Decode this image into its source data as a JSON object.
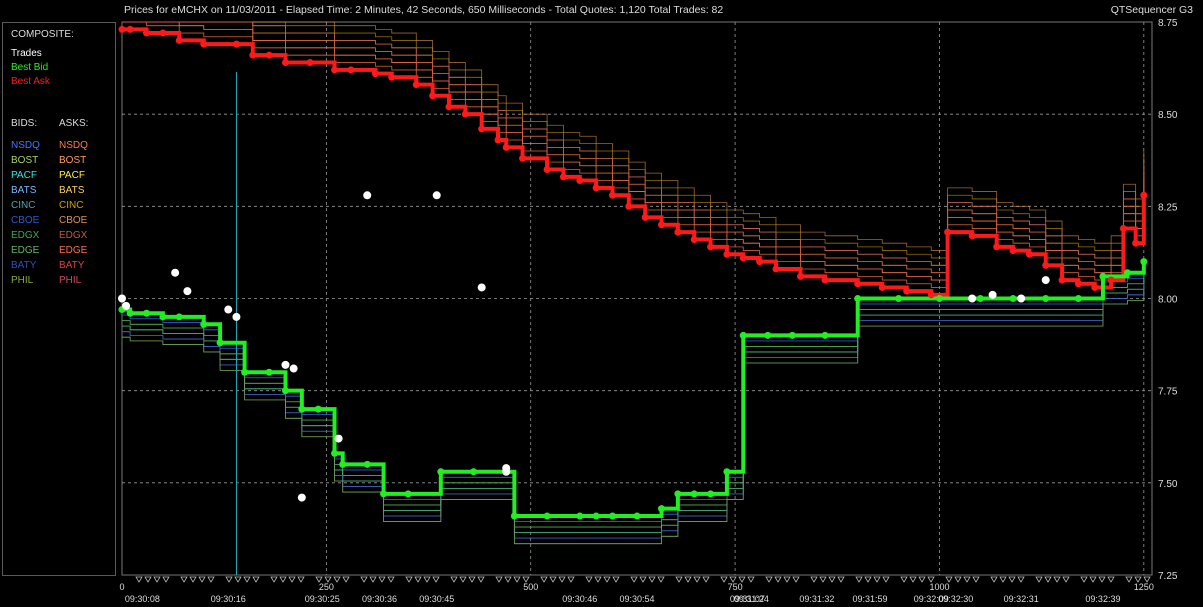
{
  "header": {
    "title": "Prices for  eMCHX  on  11/03/2011  -  Elapsed Time: 2 Minutes, 42 Seconds, 650 Milliseconds  -  Total Quotes: 1,120  Total Trades: 82",
    "brand": "QTSequencer G3"
  },
  "legend": {
    "composite_label": "COMPOSITE:",
    "trades_label": "Trades",
    "best_bid_label": "Best Bid",
    "best_ask_label": "Best Ask",
    "bids_header": "BIDS:",
    "asks_header": "ASKS:",
    "exchanges": [
      {
        "bid": "NSDQ",
        "ask": "NSDQ",
        "bid_color": "#3b78ff",
        "ask_color": "#ff7a3c"
      },
      {
        "bid": "BOST",
        "ask": "BOST",
        "bid_color": "#a8d060",
        "ask_color": "#ff9a5a"
      },
      {
        "bid": "PACF",
        "ask": "PACF",
        "bid_color": "#2ee8e0",
        "ask_color": "#ffee30"
      },
      {
        "bid": "BATS",
        "ask": "BATS",
        "bid_color": "#7fb6ff",
        "ask_color": "#ffd060"
      },
      {
        "bid": "CINC",
        "ask": "CINC",
        "bid_color": "#4aa6b0",
        "ask_color": "#d0a000"
      },
      {
        "bid": "CBOE",
        "ask": "CBOE",
        "bid_color": "#2a5ad8",
        "ask_color": "#e09050"
      },
      {
        "bid": "EDGX",
        "ask": "EDGX",
        "bid_color": "#3aa84a",
        "ask_color": "#c05a3a"
      },
      {
        "bid": "EDGE",
        "ask": "EDGE",
        "bid_color": "#64b464",
        "ask_color": "#ff6a50"
      },
      {
        "bid": "BATY",
        "ask": "BATY",
        "bid_color": "#3050c0",
        "ask_color": "#e04040"
      },
      {
        "bid": "PHIL",
        "ask": "PHIL",
        "bid_color": "#88aa40",
        "ask_color": "#d04a60"
      }
    ]
  },
  "colors": {
    "trades": "#ffffff",
    "best_bid": "#22ee22",
    "best_ask": "#ff1a1a",
    "grid": "#9a9a9a",
    "cursor": "#20b0c0"
  },
  "chart_data": {
    "type": "line",
    "title": "",
    "xlabel": "",
    "ylabel": "",
    "xlim": [
      0,
      1260
    ],
    "ylim": [
      7.25,
      8.75
    ],
    "y_ticks": [
      "8.75",
      "8.50",
      "8.25",
      "8.00",
      "7.75",
      "7.50",
      "7.25"
    ],
    "y_tick_values": [
      8.75,
      8.5,
      8.25,
      8.0,
      7.75,
      7.5,
      7.25
    ],
    "x_index_ticks": [
      "0",
      "250",
      "500",
      "750",
      "1000",
      "1250"
    ],
    "x_index_values": [
      0,
      250,
      500,
      750,
      1000,
      1250
    ],
    "x_time_ticks": [
      "09:30:08",
      "09:30:16",
      "09:30:25",
      "09:30:36",
      "09:30:45",
      "09:30:46",
      "09:30:54",
      "09:31:07",
      "09:31:24",
      "09:31:32",
      "09:31:59",
      "09:32:09",
      "09:32:30",
      "09:32:31",
      "09:32:39"
    ],
    "x_time_positions": [
      25,
      130,
      245,
      315,
      385,
      560,
      630,
      765,
      770,
      850,
      915,
      990,
      1020,
      1100,
      1200
    ],
    "cursor_x": 140,
    "series": [
      {
        "name": "Best Ask",
        "x": [
          0,
          10,
          30,
          50,
          70,
          100,
          140,
          160,
          180,
          200,
          230,
          260,
          280,
          310,
          330,
          360,
          380,
          400,
          420,
          440,
          460,
          470,
          490,
          520,
          540,
          560,
          580,
          600,
          620,
          640,
          660,
          680,
          700,
          720,
          740,
          760,
          780,
          800,
          830,
          860,
          900,
          930,
          960,
          990,
          1010,
          1040,
          1070,
          1090,
          1110,
          1130,
          1150,
          1170,
          1190,
          1210,
          1225,
          1240,
          1250
        ],
        "y": [
          8.73,
          8.73,
          8.72,
          8.72,
          8.7,
          8.69,
          8.69,
          8.66,
          8.66,
          8.64,
          8.64,
          8.62,
          8.62,
          8.61,
          8.6,
          8.58,
          8.55,
          8.52,
          8.5,
          8.46,
          8.43,
          8.41,
          8.38,
          8.35,
          8.33,
          8.32,
          8.3,
          8.28,
          8.25,
          8.22,
          8.2,
          8.18,
          8.16,
          8.14,
          8.12,
          8.11,
          8.1,
          8.08,
          8.06,
          8.05,
          8.04,
          8.03,
          8.02,
          8.01,
          8.18,
          8.17,
          8.14,
          8.13,
          8.12,
          8.09,
          8.05,
          8.04,
          8.03,
          8.05,
          8.19,
          8.15,
          8.28
        ]
      },
      {
        "name": "Best Bid",
        "x": [
          0,
          10,
          30,
          50,
          70,
          100,
          120,
          150,
          180,
          200,
          220,
          240,
          260,
          270,
          300,
          320,
          350,
          390,
          430,
          480,
          520,
          560,
          580,
          600,
          630,
          660,
          680,
          700,
          720,
          740,
          760,
          790,
          820,
          860,
          900,
          950,
          1000,
          1050,
          1090,
          1130,
          1170,
          1200,
          1230,
          1250
        ],
        "y": [
          7.97,
          7.96,
          7.96,
          7.95,
          7.95,
          7.93,
          7.88,
          7.8,
          7.8,
          7.75,
          7.7,
          7.7,
          7.58,
          7.55,
          7.55,
          7.47,
          7.47,
          7.53,
          7.53,
          7.41,
          7.41,
          7.41,
          7.41,
          7.41,
          7.41,
          7.43,
          7.47,
          7.47,
          7.47,
          7.53,
          7.9,
          7.9,
          7.9,
          7.9,
          8.0,
          8.0,
          8.0,
          8.0,
          8.0,
          8.0,
          8.0,
          8.06,
          8.07,
          8.1
        ]
      },
      {
        "name": "Trades",
        "x": [
          0,
          5,
          65,
          80,
          130,
          140,
          200,
          210,
          220,
          265,
          300,
          385,
          440,
          470,
          470,
          1040,
          1065,
          1100,
          1130
        ],
        "y": [
          8.0,
          7.98,
          8.07,
          8.02,
          7.97,
          7.95,
          7.82,
          7.81,
          7.46,
          7.62,
          8.28,
          8.28,
          8.03,
          7.53,
          7.54,
          8.0,
          8.01,
          8.0,
          8.05
        ]
      }
    ]
  }
}
